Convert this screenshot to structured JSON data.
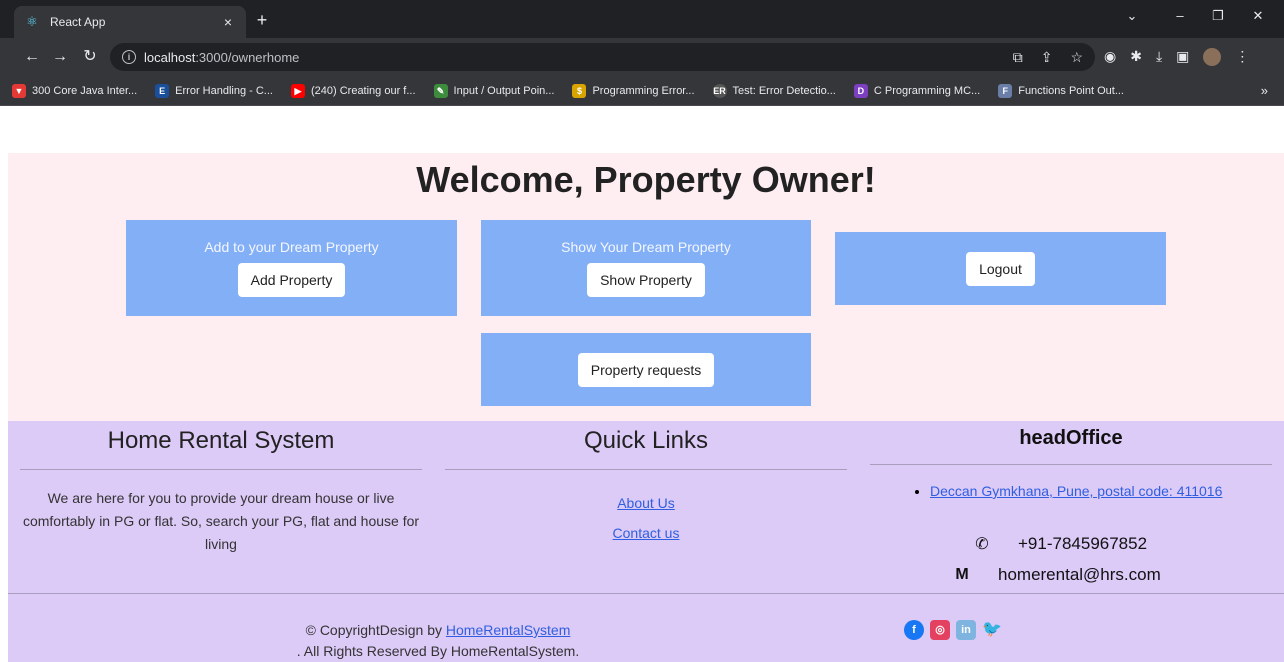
{
  "browser": {
    "tab_title": "React App",
    "tab_close": "×",
    "new_tab": "+",
    "url_host": "localhost",
    "url_path": ":3000/ownerhome",
    "window_controls": [
      "⌄",
      "–",
      "❐",
      "✕"
    ],
    "bookmarks": [
      {
        "label": "300 Core Java Inter...",
        "color": "#e53935",
        "glyph": "▼"
      },
      {
        "label": "Error Handling - C...",
        "color": "#1a4f9c",
        "glyph": "E"
      },
      {
        "label": "(240) Creating our f...",
        "color": "#ff0000",
        "glyph": "▶"
      },
      {
        "label": "Input / Output Poin...",
        "color": "#3d8b3d",
        "glyph": "✎"
      },
      {
        "label": "Programming Error...",
        "color": "#d9a400",
        "glyph": "$"
      },
      {
        "label": "Test: Error Detectio...",
        "color": "#555",
        "glyph": "ER"
      },
      {
        "label": "C Programming MC...",
        "color": "#7b3fbf",
        "glyph": "D"
      },
      {
        "label": "Functions Point Out...",
        "color": "#6a7ea8",
        "glyph": "F"
      }
    ],
    "bookmarks_more": "»"
  },
  "hero": {
    "title": "Welcome, Property Owner!",
    "cards": {
      "add": {
        "label": "Add to your Dream Property",
        "button": "Add Property"
      },
      "show": {
        "label": "Show Your Dream Property",
        "button": "Show Property"
      },
      "logout": {
        "button": "Logout"
      },
      "requests": {
        "button": "Property requests"
      }
    }
  },
  "footer": {
    "about": {
      "title": "Home Rental System",
      "text": "We are here for you to provide your dream house or live comfortably in PG or flat. So, search your PG, flat and house for living"
    },
    "quick_links": {
      "title": "Quick Links",
      "links": [
        "About Us",
        "Contact us"
      ]
    },
    "head_office": {
      "title": "headOffice",
      "address": "Deccan Gymkhana, Pune, postal code: 411016",
      "phone": "+91-7845967852",
      "email": "homerental@hrs.com"
    },
    "copyright": {
      "prefix": "© CopyrightDesign by ",
      "link": "HomeRentalSystem",
      "suffix": ". All Rights Reserved By HomeRentalSystem."
    },
    "socials": [
      {
        "name": "facebook",
        "color": "#1877f2",
        "glyph": "f"
      },
      {
        "name": "instagram",
        "color": "#e4405f",
        "glyph": "◎"
      },
      {
        "name": "linkedin",
        "color": "#7fb4e0",
        "glyph": "in"
      },
      {
        "name": "twitter",
        "color": "#1da1f2",
        "glyph": "🐦"
      }
    ]
  }
}
